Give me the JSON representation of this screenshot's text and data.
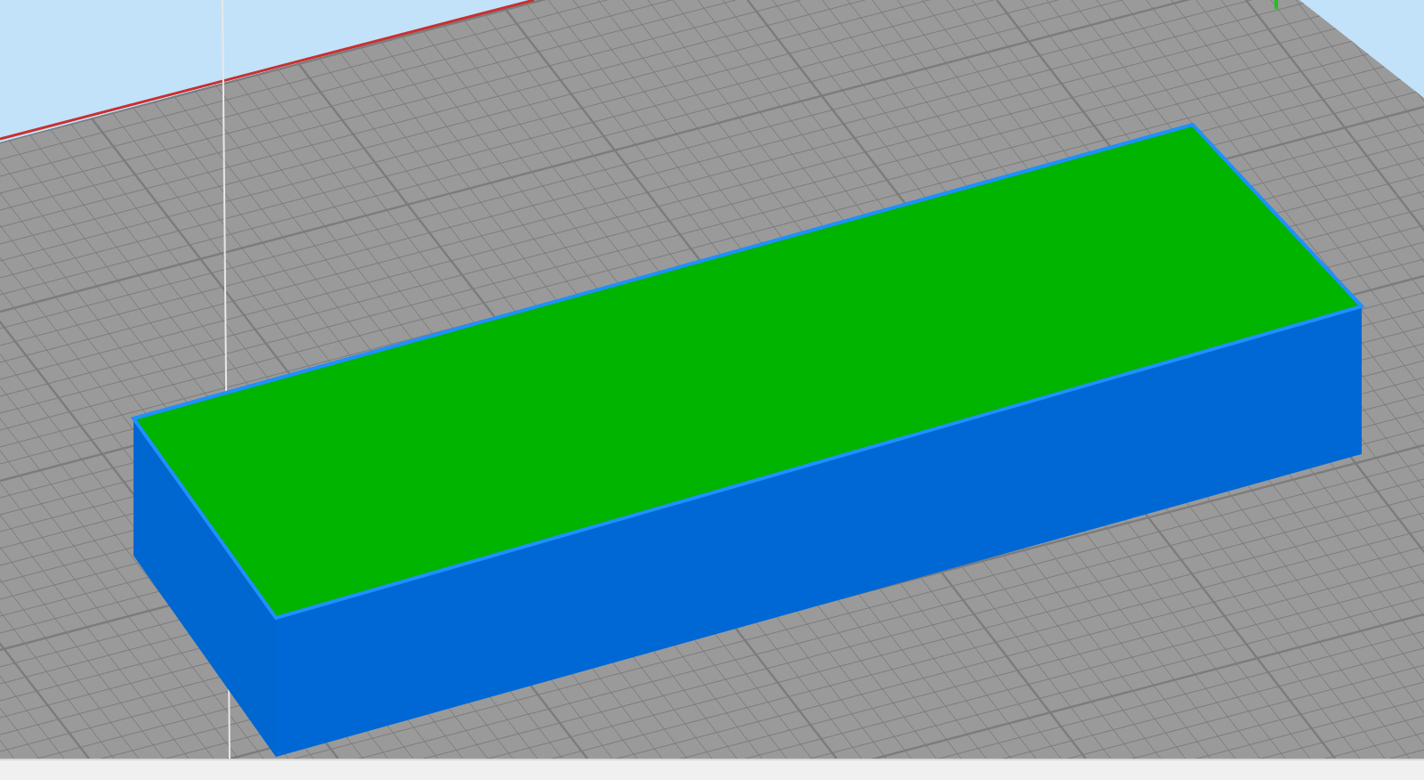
{
  "viewport": {
    "model": {
      "kind": "box"
    }
  }
}
